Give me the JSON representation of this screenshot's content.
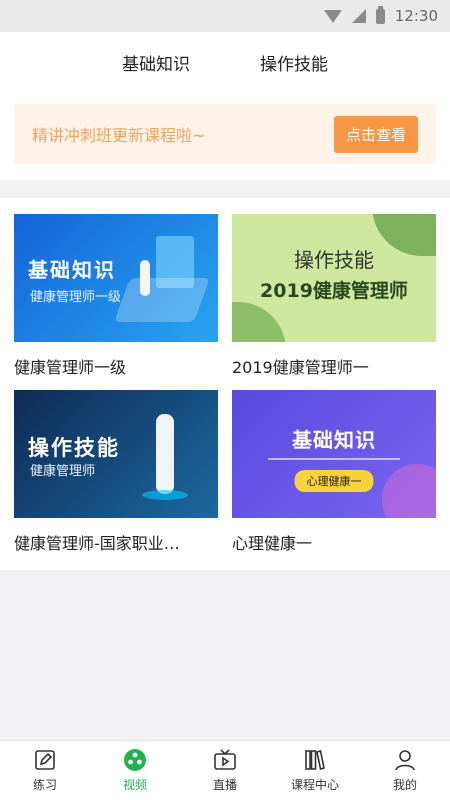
{
  "status_bar": {
    "time": "12:30"
  },
  "top_tabs": [
    "基础知识",
    "操作技能"
  ],
  "banner": {
    "text": "精讲冲刺班更新课程啦~",
    "button": "点击查看"
  },
  "courses": [
    {
      "title": "健康管理师一级",
      "thumb_big": "基础知识",
      "thumb_sub": "健康管理师一级"
    },
    {
      "title": "2019健康管理师一",
      "thumb_big": "操作技能",
      "thumb_sub": "2019健康管理师"
    },
    {
      "title": "健康管理师-国家职业…",
      "thumb_big": "操作技能",
      "thumb_sub": "健康管理师"
    },
    {
      "title": "心理健康一",
      "thumb_big": "基础知识",
      "thumb_sub": "心理健康一"
    }
  ],
  "bottom_nav": [
    {
      "label": "练习",
      "icon": "pencil-icon"
    },
    {
      "label": "视频",
      "icon": "film-reel-icon",
      "active": true
    },
    {
      "label": "直播",
      "icon": "tv-icon"
    },
    {
      "label": "课程中心",
      "icon": "books-icon"
    },
    {
      "label": "我的",
      "icon": "person-icon"
    }
  ],
  "colors": {
    "accent_green": "#22b14c",
    "banner_orange": "#f59745"
  }
}
